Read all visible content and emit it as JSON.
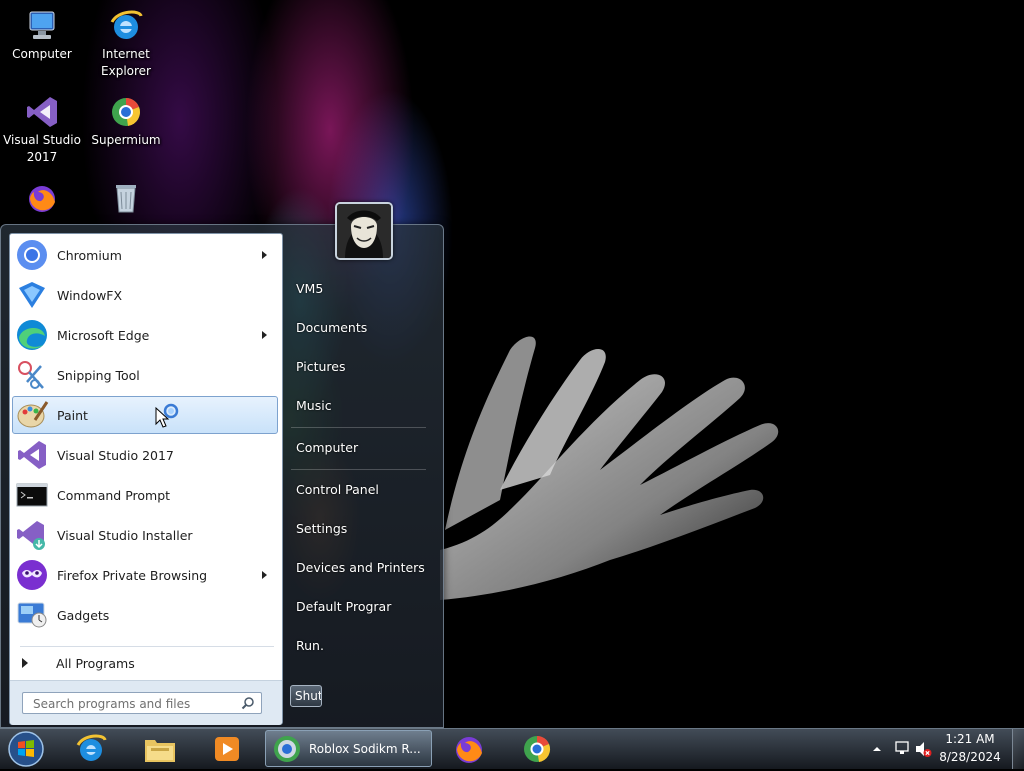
{
  "desktop": {
    "icons": [
      {
        "label": "Computer"
      },
      {
        "label": "Internet\nExplorer"
      },
      {
        "label": "Visual Studio\n2017"
      },
      {
        "label": "Supermium"
      }
    ]
  },
  "start_menu": {
    "programs": [
      {
        "label": "Chromium",
        "has_submenu": true
      },
      {
        "label": "WindowFX",
        "has_submenu": false
      },
      {
        "label": "Microsoft Edge",
        "has_submenu": true
      },
      {
        "label": "Snipping Tool",
        "has_submenu": false
      },
      {
        "label": "Paint",
        "has_submenu": false,
        "highlighted": true
      },
      {
        "label": "Visual Studio 2017",
        "has_submenu": false
      },
      {
        "label": "Command Prompt",
        "has_submenu": false
      },
      {
        "label": "Visual Studio Installer",
        "has_submenu": false
      },
      {
        "label": "Firefox Private Browsing",
        "has_submenu": true
      },
      {
        "label": "Gadgets",
        "has_submenu": false
      }
    ],
    "all_programs_label": "All Programs",
    "search_placeholder": "Search programs and files",
    "places": [
      {
        "label": "VM5"
      },
      {
        "label": "Documents"
      },
      {
        "label": "Pictures"
      },
      {
        "label": "Music"
      },
      {
        "label": "Computer"
      },
      {
        "label": "Control Panel"
      },
      {
        "label": "Settings"
      },
      {
        "label": "Devices and Printers"
      },
      {
        "label": "Default Prograr"
      },
      {
        "label": "Run."
      }
    ],
    "shutdown_label": "Shut"
  },
  "taskbar": {
    "active_window_label": "Roblox Sodikm R...",
    "clock_time": "1:21 AM",
    "clock_date": "8/28/2024"
  },
  "colors": {
    "highlight": "#c9e2fa",
    "taskbar": "#2a3038",
    "menu_frame": "#2d3640"
  }
}
